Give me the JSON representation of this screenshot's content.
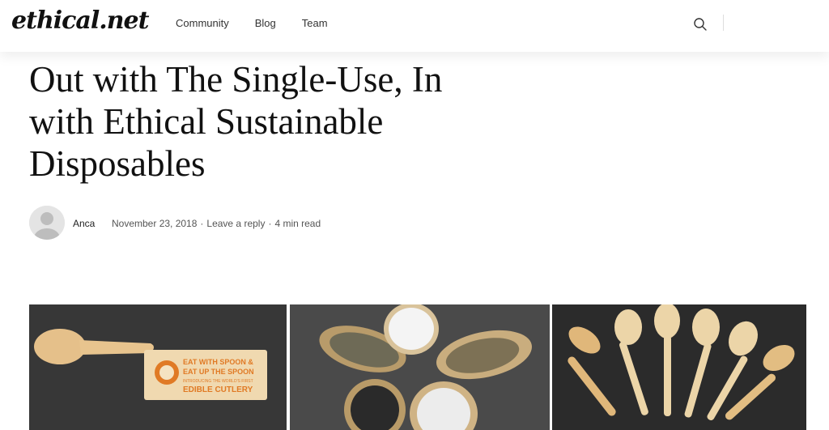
{
  "site": {
    "logo_text": "ethical.net"
  },
  "nav": {
    "items": [
      {
        "label": "Community"
      },
      {
        "label": "Blog"
      },
      {
        "label": "Team"
      }
    ]
  },
  "article": {
    "title": "Out with The Single-Use, In with Ethical Sustainable Disposables",
    "author": "Anca",
    "date": "November 23, 2018",
    "reply_label": "Leave a reply",
    "read_time": "4 min read"
  },
  "photo1": {
    "label_line1": "EAT WITH SPOON &",
    "label_line2": "EAT UP THE SPOON",
    "label_line3": "INTRODUCING THE WORLD'S FIRST",
    "label_line4": "EDIBLE CUTLERY"
  },
  "colors": {
    "accent": "#111111",
    "photo_bg": "#3a3a3a",
    "spoon": "#e8c48e",
    "label_orange": "#e07a25"
  }
}
